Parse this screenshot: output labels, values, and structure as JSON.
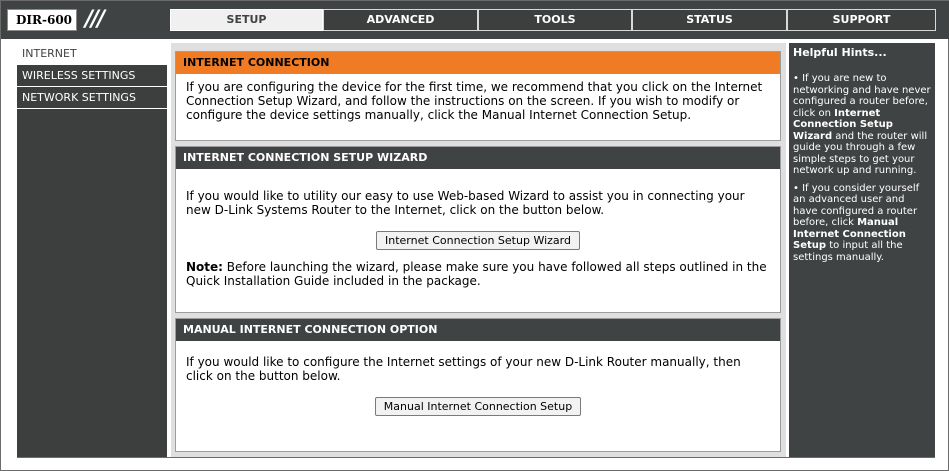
{
  "logo": {
    "model": "DIR-600",
    "slashes": "///"
  },
  "tabs": [
    {
      "label": "SETUP",
      "active": true
    },
    {
      "label": "ADVANCED",
      "active": false
    },
    {
      "label": "TOOLS",
      "active": false
    },
    {
      "label": "STATUS",
      "active": false
    },
    {
      "label": "SUPPORT",
      "active": false
    }
  ],
  "sidebar": {
    "items": [
      {
        "label": "INTERNET",
        "active": true
      },
      {
        "label": "WIRELESS SETTINGS",
        "active": false
      },
      {
        "label": "NETWORK SETTINGS",
        "active": false
      }
    ]
  },
  "internet_connection": {
    "title": "INTERNET CONNECTION",
    "text": "If you are configuring the device for the first time, we recommend that you click on the Internet Connection Setup Wizard, and follow the instructions on the screen. If you wish to modify or configure the device settings manually, click the Manual Internet Connection Setup."
  },
  "wizard_section": {
    "title": "INTERNET CONNECTION SETUP WIZARD",
    "text": "If you would like to utility our easy to use Web-based Wizard to assist you in connecting your new D-Link Systems Router to the Internet, click on the button below.",
    "button": "Internet Connection Setup Wizard",
    "note_label": "Note:",
    "note_text": " Before launching the wizard, please make sure you have followed all steps outlined in the Quick Installation Guide included in the package."
  },
  "manual_section": {
    "title": "MANUAL INTERNET CONNECTION OPTION",
    "text": "If you would like to configure the Internet settings of your new D-Link Router manually, then click on the button below.",
    "button": "Manual Internet Connection Setup"
  },
  "hints": {
    "title": "Helpful Hints...",
    "hint1_pre": "If you are new to networking and have never configured a router before, click on ",
    "hint1_bold": "Internet Connection Setup Wizard",
    "hint1_post": " and the router will guide you through a few simple steps to get your network up and running.",
    "hint2_pre": "If you consider yourself an advanced user and have configured a router before, click ",
    "hint2_bold": "Manual Internet Connection Setup",
    "hint2_post": " to input all the settings manually."
  },
  "colors": {
    "nav_bg": "#404343",
    "orange_header": "#ef7c25",
    "main_bg": "#dfdfdf"
  }
}
